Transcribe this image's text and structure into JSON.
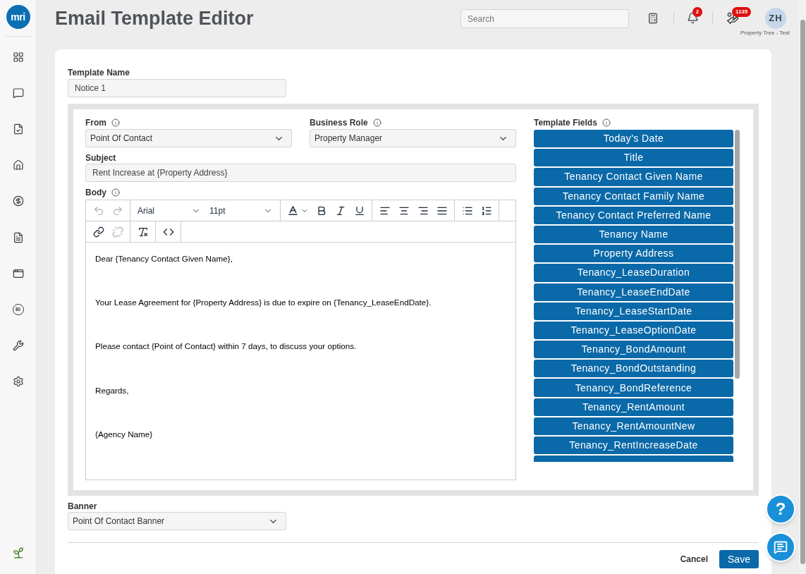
{
  "sidebar": {
    "logo": "mri",
    "items": [
      {
        "kind": "grid",
        "selected": false
      },
      {
        "kind": "chat",
        "selected": false
      },
      {
        "kind": "checklist",
        "selected": false
      },
      {
        "kind": "home",
        "selected": false
      },
      {
        "kind": "dollar",
        "selected": false
      },
      {
        "kind": "document",
        "selected": false
      },
      {
        "kind": "window",
        "selected": false
      },
      {
        "kind": "circle-text",
        "text": "BI",
        "selected": false
      },
      {
        "kind": "wrench",
        "selected": false
      },
      {
        "kind": "gear",
        "selected": false
      }
    ]
  },
  "header": {
    "title": "Email Template Editor",
    "search": {
      "placeholder": "Search"
    },
    "notifications": {
      "badge": "2"
    },
    "tasks": {
      "badge": "1135"
    },
    "user": {
      "initials": "ZH",
      "account": "Property Tree - Test"
    }
  },
  "form": {
    "template_name": {
      "label": "Template Name",
      "value": "Notice 1",
      "info": false
    },
    "from": {
      "label": "From",
      "value": "Point Of Contact",
      "info": true
    },
    "business_role": {
      "label": "Business Role",
      "value": "Property Manager",
      "info": true
    },
    "subject": {
      "label": "Subject",
      "value": "Rent Increase at {Property Address}",
      "info": false
    },
    "body": {
      "label": "Body",
      "info": true,
      "toolbar": [
        [
          {
            "tools": [
              {
                "kind": "undo",
                "disabled": true
              },
              {
                "kind": "redo",
                "disabled": true
              }
            ]
          },
          {
            "tools": [
              {
                "kind": "select",
                "value": "Arial",
                "disabled": false
              },
              {
                "kind": "select",
                "value": "11pt",
                "disabled": false
              }
            ]
          },
          {
            "tools": [
              {
                "kind": "text-color",
                "disabled": false
              },
              {
                "kind": "bold",
                "disabled": false
              },
              {
                "kind": "italic",
                "disabled": false
              },
              {
                "kind": "underline",
                "disabled": false
              }
            ]
          },
          {
            "tools": [
              {
                "kind": "align-left",
                "disabled": false
              },
              {
                "kind": "align-center",
                "disabled": false
              },
              {
                "kind": "align-right",
                "disabled": false
              },
              {
                "kind": "align-justify",
                "disabled": false
              }
            ]
          },
          {
            "tools": [
              {
                "kind": "bullet-list",
                "disabled": false
              },
              {
                "kind": "numbered-list",
                "disabled": false
              }
            ]
          }
        ],
        [
          {
            "tools": [
              {
                "kind": "link",
                "disabled": false
              },
              {
                "kind": "unlink",
                "disabled": true
              }
            ]
          },
          {
            "tools": [
              {
                "kind": "clear-format",
                "disabled": false
              }
            ]
          },
          {
            "tools": [
              {
                "kind": "code",
                "disabled": false
              }
            ]
          }
        ]
      ],
      "paragraphs": [
        "Dear {Tenancy Contact Given Name},",
        "Your Lease Agreement for {Property Address} is due to expire on {Tenancy_LeaseEndDate}.",
        "Please contact {Point of Contact} within 7 days, to discuss your options.",
        "Regards,",
        "{Agency Name}"
      ]
    },
    "template_fields": {
      "label": "Template Fields",
      "info": true,
      "items": [
        "Today's Date",
        "Title",
        "Tenancy Contact Given Name",
        "Tenancy Contact Family Name",
        "Tenancy Contact Preferred Name",
        "Tenancy Name",
        "Property Address",
        "Tenancy_LeaseDuration",
        "Tenancy_LeaseEndDate",
        "Tenancy_LeaseStartDate",
        "Tenancy_LeaseOptionDate",
        "Tenancy_BondAmount",
        "Tenancy_BondOutstanding",
        "Tenancy_BondReference",
        "Tenancy_RentAmount",
        "Tenancy_RentAmountNew",
        "Tenancy_RentIncreaseDate"
      ]
    },
    "banner": {
      "label": "Banner",
      "value": "Point Of Contact Banner",
      "info": false
    },
    "actions": {
      "cancel": "Cancel",
      "save": "Save"
    }
  },
  "help": {
    "label": "?"
  }
}
